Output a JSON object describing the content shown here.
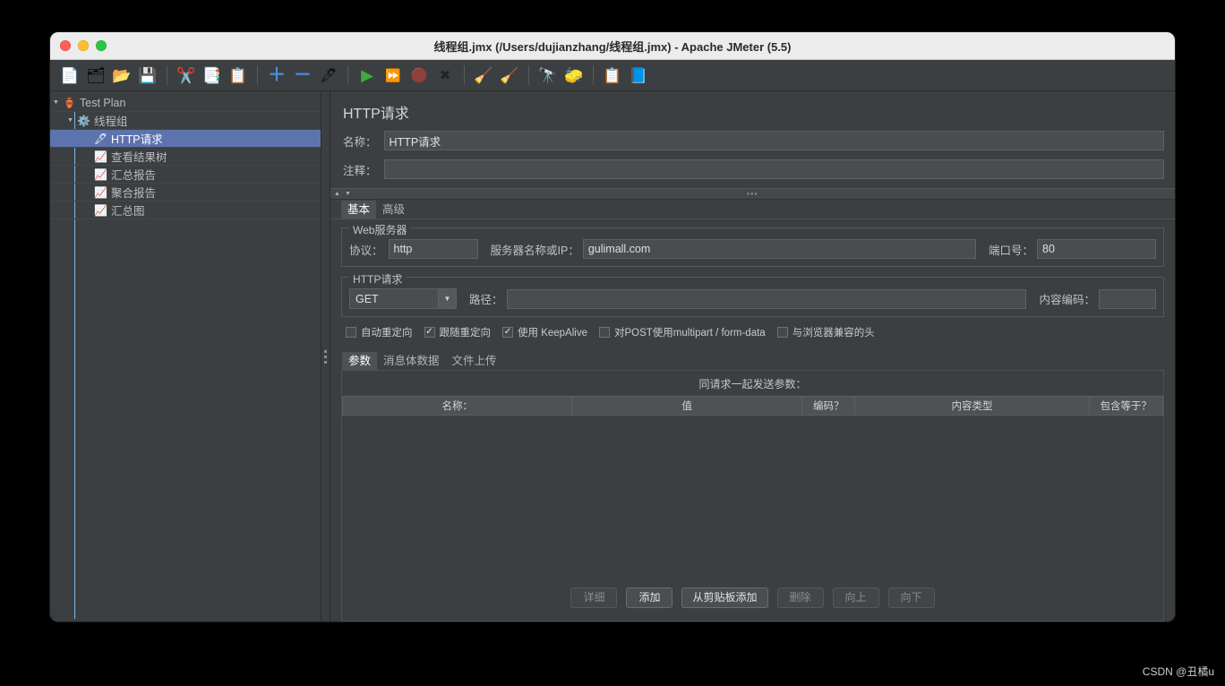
{
  "window": {
    "title": "线程组.jmx (/Users/dujianzhang/线程组.jmx) - Apache JMeter (5.5)"
  },
  "toolbar": {
    "buttons": [
      {
        "name": "new",
        "icon": "📄"
      },
      {
        "name": "templates",
        "icon": "🗂"
      },
      {
        "name": "open",
        "icon": "📂"
      },
      {
        "name": "save",
        "icon": "💾"
      },
      {
        "name": "cut",
        "icon": "✂️"
      },
      {
        "name": "copy",
        "icon": "📑"
      },
      {
        "name": "paste",
        "icon": "📋"
      },
      {
        "name": "expand-all",
        "icon": "＋"
      },
      {
        "name": "collapse-all",
        "icon": "－"
      },
      {
        "name": "toggle",
        "icon": "🖊"
      },
      {
        "name": "start",
        "icon": "▶"
      },
      {
        "name": "start-no-timers",
        "icon": "⏩"
      },
      {
        "name": "stop",
        "icon": "🛑"
      },
      {
        "name": "shutdown",
        "icon": "✖"
      },
      {
        "name": "clear",
        "icon": "🧹"
      },
      {
        "name": "clear-all",
        "icon": "🧹"
      },
      {
        "name": "search",
        "icon": "🔭"
      },
      {
        "name": "reset-search",
        "icon": "🧽"
      },
      {
        "name": "function-helper",
        "icon": "📋"
      },
      {
        "name": "help",
        "icon": "📘"
      }
    ]
  },
  "tree": {
    "nodes": [
      {
        "label": "Test Plan",
        "icon": "🏺",
        "depth": 0,
        "twisty": "▼",
        "selected": false
      },
      {
        "label": "线程组",
        "icon": "⚙️",
        "depth": 1,
        "twisty": "▼",
        "selected": false
      },
      {
        "label": "HTTP请求",
        "icon": "🖋",
        "depth": 2,
        "twisty": "",
        "selected": true
      },
      {
        "label": "查看结果树",
        "icon": "📈",
        "depth": 2,
        "twisty": "",
        "selected": false
      },
      {
        "label": "汇总报告",
        "icon": "📈",
        "depth": 2,
        "twisty": "",
        "selected": false
      },
      {
        "label": "聚合报告",
        "icon": "📈",
        "depth": 2,
        "twisty": "",
        "selected": false
      },
      {
        "label": "汇总图",
        "icon": "📈",
        "depth": 2,
        "twisty": "",
        "selected": false
      }
    ]
  },
  "panel": {
    "title": "HTTP请求",
    "name_label": "名称：",
    "name_value": "HTTP请求",
    "comment_label": "注释：",
    "comment_value": "",
    "collapse_dots": "•••"
  },
  "tabs": {
    "items": [
      {
        "label": "基本",
        "active": true
      },
      {
        "label": "高级",
        "active": false
      }
    ]
  },
  "webserver": {
    "group_title": "Web服务器",
    "protocol_label": "协议：",
    "protocol_value": "http",
    "host_label": "服务器名称或IP：",
    "host_value": "gulimall.com",
    "port_label": "端口号：",
    "port_value": "80"
  },
  "httprequest": {
    "group_title": "HTTP请求",
    "method_value": "GET",
    "path_label": "路径：",
    "path_value": "",
    "encoding_label": "内容编码：",
    "encoding_value": ""
  },
  "checkboxes": [
    {
      "label": "自动重定向",
      "checked": false
    },
    {
      "label": "跟随重定向",
      "checked": true
    },
    {
      "label": "使用 KeepAlive",
      "checked": true
    },
    {
      "label": "对POST使用multipart / form-data",
      "checked": false
    },
    {
      "label": "与浏览器兼容的头",
      "checked": false
    }
  ],
  "inner_tabs": {
    "items": [
      {
        "label": "参数",
        "active": true
      },
      {
        "label": "消息体数据",
        "active": false
      },
      {
        "label": "文件上传",
        "active": false
      }
    ]
  },
  "param_table": {
    "caption": "同请求一起发送参数：",
    "columns": [
      "名称：",
      "值",
      "编码？",
      "内容类型",
      "包含等于？"
    ],
    "rows": []
  },
  "bottom_buttons": [
    {
      "label": "详细",
      "disabled": true
    },
    {
      "label": "添加",
      "disabled": false
    },
    {
      "label": "从剪贴板添加",
      "disabled": false
    },
    {
      "label": "删除",
      "disabled": true
    },
    {
      "label": "向上",
      "disabled": true
    },
    {
      "label": "向下",
      "disabled": true
    }
  ],
  "watermark": "CSDN @丑橘u"
}
